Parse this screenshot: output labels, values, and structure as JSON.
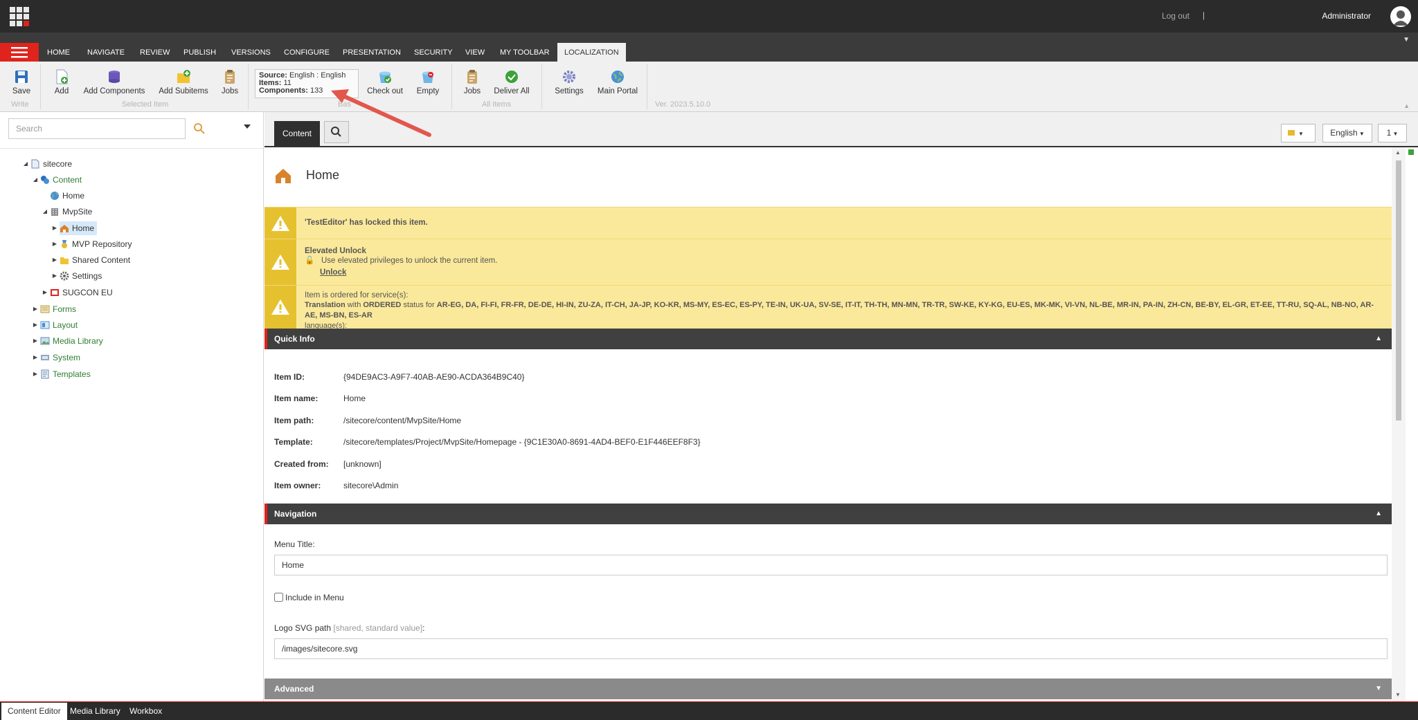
{
  "topbar": {
    "logout": "Log out",
    "separator": "|",
    "username": "Administrator"
  },
  "ribbon_tabs": [
    "HOME",
    "NAVIGATE",
    "REVIEW",
    "PUBLISH",
    "VERSIONS",
    "CONFIGURE",
    "PRESENTATION",
    "SECURITY",
    "VIEW",
    "MY TOOLBAR",
    "LOCALIZATION"
  ],
  "active_tab": "LOCALIZATION",
  "ribbon": {
    "save": "Save",
    "write_group": "Write",
    "add": "Add",
    "add_components": "Add Components",
    "add_subitems": "Add Subitems",
    "jobs": "Jobs",
    "selected_group": "Selected Item",
    "source_label": "Source:",
    "source_value": "English : English",
    "items_label": "Items:",
    "items_value": "11",
    "components_label": "Components:",
    "components_value": "133",
    "check_out": "Check out",
    "empty": "Empty",
    "jobs2": "Jobs",
    "deliver_all": "Deliver All",
    "all_group": "All Items",
    "settings": "Settings",
    "main_portal": "Main Portal",
    "version": "Ver. 2023.5.10.0"
  },
  "search": {
    "placeholder": "Search"
  },
  "tree": [
    {
      "label": "sitecore"
    },
    {
      "label": "Content"
    },
    {
      "label": "Home"
    },
    {
      "label": "MvpSite"
    },
    {
      "label": "Home"
    },
    {
      "label": "MVP Repository"
    },
    {
      "label": "Shared Content"
    },
    {
      "label": "Settings"
    },
    {
      "label": "SUGCON EU"
    },
    {
      "label": "Forms"
    },
    {
      "label": "Layout"
    },
    {
      "label": "Media Library"
    },
    {
      "label": "System"
    },
    {
      "label": "Templates"
    }
  ],
  "editor_tabs": {
    "content": "Content",
    "language": "English",
    "version": "1"
  },
  "item": {
    "title": "Home"
  },
  "warnings": {
    "locked": "'TestEditor' has locked this item.",
    "elevated_title": "Elevated Unlock",
    "elevated_text": "Use elevated privileges to unlock the current item.",
    "unlock": "Unlock",
    "ordered_line1": "Item is ordered for service(s):",
    "ordered_translation": "Translation",
    "ordered_with": "with",
    "ordered_status": "ORDERED",
    "ordered_status_for": "status for",
    "ordered_langs": "AR-EG, DA, FI-FI, FR-FR, DE-DE, HI-IN, ZU-ZA, IT-CH, JA-JP, KO-KR, MS-MY, ES-EC, ES-PY, TE-IN, UK-UA, SV-SE, IT-IT, TH-TH, MN-MN, TR-TR, SW-KE, KY-KG, EU-ES, MK-MK, VI-VN, NL-BE, MR-IN, PA-IN, ZH-CN, BE-BY, EL-GR, ET-EE, TT-RU, SQ-AL, NB-NO, AR-AE, MS-BN, ES-AR",
    "ordered_tail": "language(s):"
  },
  "quick_info": {
    "title": "Quick Info",
    "rows": [
      {
        "k": "Item ID:",
        "v": "{94DE9AC3-A9F7-40AB-AE90-ACDA364B9C40}"
      },
      {
        "k": "Item name:",
        "v": "Home"
      },
      {
        "k": "Item path:",
        "v": "/sitecore/content/MvpSite/Home"
      },
      {
        "k": "Template:",
        "v": "/sitecore/templates/Project/MvpSite/Homepage - {9C1E30A0-8691-4AD4-BEF0-E1F446EEF8F3}"
      },
      {
        "k": "Created from:",
        "v": "[unknown]"
      },
      {
        "k": "Item owner:",
        "v": "sitecore\\Admin"
      }
    ]
  },
  "navigation": {
    "title": "Navigation",
    "menu_title_label": "Menu Title:",
    "menu_title_value": "Home",
    "include_in_menu": "Include in Menu",
    "logo_label": "Logo SVG path",
    "logo_note": "[shared, standard value]",
    "logo_colon": ":",
    "logo_value": "/images/sitecore.svg"
  },
  "advanced": {
    "title": "Advanced"
  },
  "bottom_tabs": [
    "Content Editor",
    "Media Library",
    "Workbox"
  ],
  "colors": {
    "accent": "#e0231c",
    "warning": "#fbe99b",
    "tree_green": "#2e7d32"
  }
}
